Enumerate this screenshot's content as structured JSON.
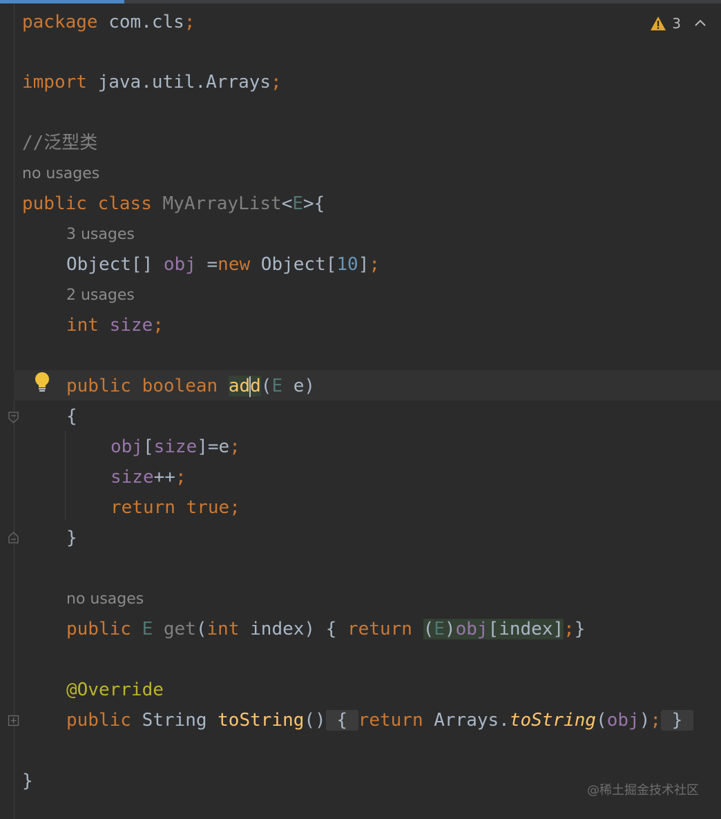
{
  "editor": {
    "language": "java",
    "inspection": {
      "warning_count": "3"
    },
    "watermark": "@稀土掘金技术社区",
    "code": {
      "l1": {
        "kw": "package",
        "rest": " com.cls",
        "semi": ";"
      },
      "l2": {
        "kw": "import",
        "rest": " java.util.Arrays",
        "semi": ";"
      },
      "l3": {
        "comment": "//泛型类"
      },
      "h1": "no usages",
      "l4": {
        "public": "public",
        "class": "class",
        "name": "MyArrayList",
        "lt": "<",
        "E": "E",
        "gt": ">{"
      },
      "h2": "3 usages",
      "l5": {
        "type": "Object[]",
        "var": "obj",
        "eq": " =",
        "new": "new",
        "type2": "Object[",
        "num": "10",
        "end": "]",
        "semi": ";"
      },
      "h3": "2 usages",
      "l6": {
        "int": "int",
        "var": "size",
        "semi": ";"
      },
      "l7": {
        "public": "public",
        "boolean": "boolean",
        "name_a": "ad",
        "name_b": "d",
        "paren_open": "(",
        "E": "E",
        "param": " e)"
      },
      "l8": {
        "brace": "{"
      },
      "l9": {
        "obj": "obj",
        "lb": "[",
        "size": "size",
        "rest": "]=e",
        "semi": ";"
      },
      "l10": {
        "size": "size",
        "rest": "++",
        "semi": ";"
      },
      "l11": {
        "return": "return",
        "true": "true",
        "semi": ";"
      },
      "l12": {
        "brace": "}"
      },
      "h4": "no usages",
      "l13": {
        "public": "public",
        "E": "E",
        "name": "get",
        "po": "(",
        "int": "int",
        "param": " index) { ",
        "return": "return",
        "cast_o": "(",
        "cast_E": "E",
        "cast_c": ")",
        "obj": "obj",
        "idx": "[index]",
        "semi": ";",
        "close": "}"
      },
      "l14": {
        "annotation": "@Override"
      },
      "l15": {
        "public": "public",
        "type": "String",
        "name": "toString",
        "parens": "()",
        "ob": "{",
        "return": "return",
        "cls": "Arrays.",
        "method": "toString",
        "po": "(",
        "obj": "obj",
        "pc": ")",
        "semi": ";",
        "cb": "}"
      },
      "l16": {
        "brace": "}"
      }
    }
  }
}
